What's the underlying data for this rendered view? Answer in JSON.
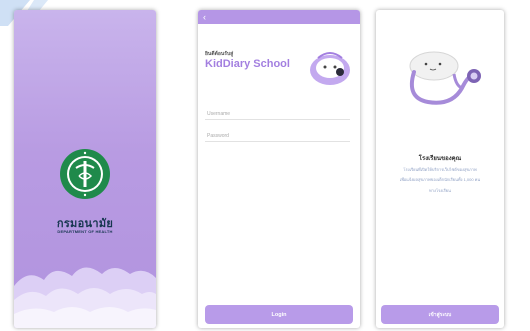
{
  "splash": {
    "dept_thai": "กรมอนามัย",
    "dept_english": "DEPARTMENT OF HEALTH"
  },
  "login": {
    "welcome": "ยินดีต้อนรับสู่",
    "brand": "KidDiary School",
    "username_placeholder": "Username",
    "password_placeholder": "Password",
    "login_button": "Login"
  },
  "onboarding": {
    "title": "โรงเรียนของคุณ",
    "lines": [
      "โรงเรียนที่เปิดให้บริการเว็บไซต์ของสุขภาพ",
      "เพื่อแจ้งผลสุขภาพของเด็กนักเรียนทั้ง 1,000 คน",
      "ทางโรงเรียน"
    ],
    "next_button": "เข้าสู่ระบบ"
  },
  "colors": {
    "accent": "#b89be9",
    "brand_text": "#a37fe0",
    "emblem_green": "#1f8a4b"
  }
}
